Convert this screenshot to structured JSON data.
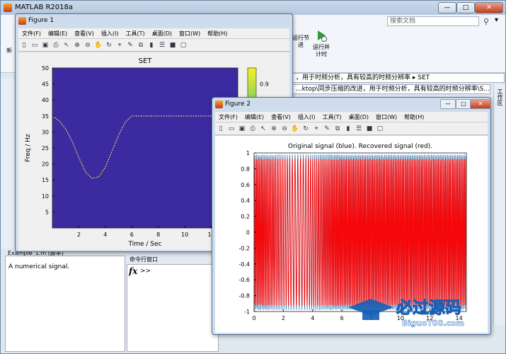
{
  "main": {
    "title": "MATLAB R2018a",
    "search_placeholder": "搜索文档",
    "ribbon_buttons": [
      "运行节",
      "运行并计时"
    ],
    "ribbon_partial": [
      "新",
      "进"
    ],
    "address1": "...ktop\\同步压缩的改进，用于时频分析，具有较高的时频分辨率 ▸ SET",
    "address2": "...ktop\\同步压缩的改进，用于时频分析，具有较高的时频分辨率\\S...",
    "address1_prefix": "，用于时频分析，具有较高的时频分辨率 ▸ SET",
    "detail_header": "Example_1.m  (脚本)",
    "detail_text": "A numerical signal.",
    "cmd_header": "命令行窗口",
    "cmd_prompt": ">>",
    "fx": "fx",
    "right_label": "工作区",
    "controls": {
      "minimize": "—",
      "maximize": "□",
      "close": "✕"
    }
  },
  "figure1": {
    "title": "Figure 1",
    "menus": [
      "文件(F)",
      "编辑(E)",
      "查看(V)",
      "插入(I)",
      "工具(T)",
      "桌面(D)",
      "窗口(W)",
      "帮助(H)"
    ],
    "plot_title": "SET",
    "ylabel": "Freq / Hz",
    "xlabel": "Time / Sec",
    "yticks": [
      "50",
      "45",
      "40",
      "35",
      "30",
      "25",
      "20",
      "15",
      "10",
      "5"
    ],
    "xticks": [
      "2",
      "4",
      "6",
      "8",
      "10",
      "12"
    ],
    "colorbar_tick": "0.9"
  },
  "figure2": {
    "title": "Figure 2",
    "menus": [
      "文件(F)",
      "编辑(E)",
      "查看(V)",
      "插入(I)",
      "工具(T)",
      "桌面(D)",
      "窗口(W)",
      "帮助(H)"
    ],
    "plot_title": "Original signal (blue). Recovered signal (red).",
    "yticks": [
      "1",
      "0.8",
      "0.6",
      "0.4",
      "0.2",
      "0",
      "-0.2",
      "-0.4",
      "-0.6",
      "-0.8",
      "-1"
    ],
    "xticks": [
      "0",
      "2",
      "4",
      "6",
      "8",
      "10",
      "12",
      "14"
    ]
  },
  "chart_data": [
    {
      "type": "heatmap",
      "title": "SET",
      "xlabel": "Time / Sec",
      "ylabel": "Freq / Hz",
      "xlim": [
        0,
        14
      ],
      "ylim": [
        0,
        50
      ],
      "ridge": {
        "x": [
          0,
          0.5,
          1,
          1.5,
          2,
          2.5,
          3,
          3.5,
          4,
          4.5,
          5,
          5.5,
          6,
          7,
          8,
          9,
          10,
          11,
          12,
          13,
          14
        ],
        "y": [
          35,
          33.5,
          31,
          27,
          22,
          17.5,
          15.5,
          16,
          19,
          24,
          29,
          33,
          35,
          35,
          35,
          35,
          35,
          35,
          35,
          35,
          35
        ]
      },
      "colorbar_tick": 0.9
    },
    {
      "type": "line",
      "title": "Original signal (blue). Recovered signal (red).",
      "xlim": [
        0,
        14.5
      ],
      "ylim": [
        -1,
        1
      ],
      "series": [
        {
          "color": "#1f77b4"
        },
        {
          "color": "#ff0000"
        }
      ]
    }
  ],
  "watermark": {
    "text": "必过源码",
    "sub": "BiguoT00.com"
  }
}
